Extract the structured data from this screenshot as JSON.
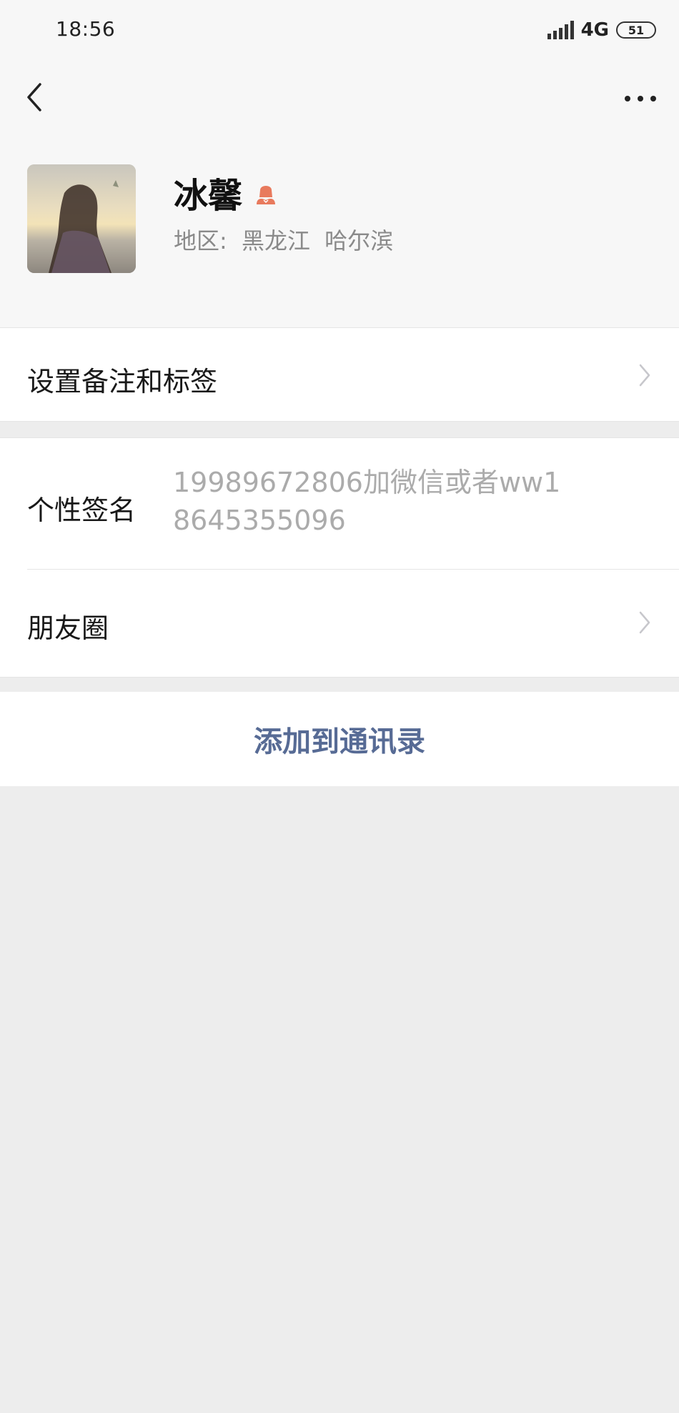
{
  "status_bar": {
    "time": "18:56",
    "network": "4G",
    "battery": "51"
  },
  "nav": {
    "back_icon": "chevron-left-icon",
    "more_icon": "ellipsis-icon"
  },
  "profile": {
    "nickname": "冰馨",
    "gender_icon": "female-icon",
    "gender_color": "#e87a5d",
    "region_label": "地区:",
    "region_province": "黑龙江",
    "region_city": "哈尔滨"
  },
  "cells": {
    "remark_label": "设置备注和标签",
    "signature_label": "个性签名",
    "signature_value": "19989672806加微信或者ww18645355096",
    "moments_label": "朋友圈"
  },
  "actions": {
    "add_contact_label": "添加到通讯录",
    "link_color": "#576b95"
  }
}
